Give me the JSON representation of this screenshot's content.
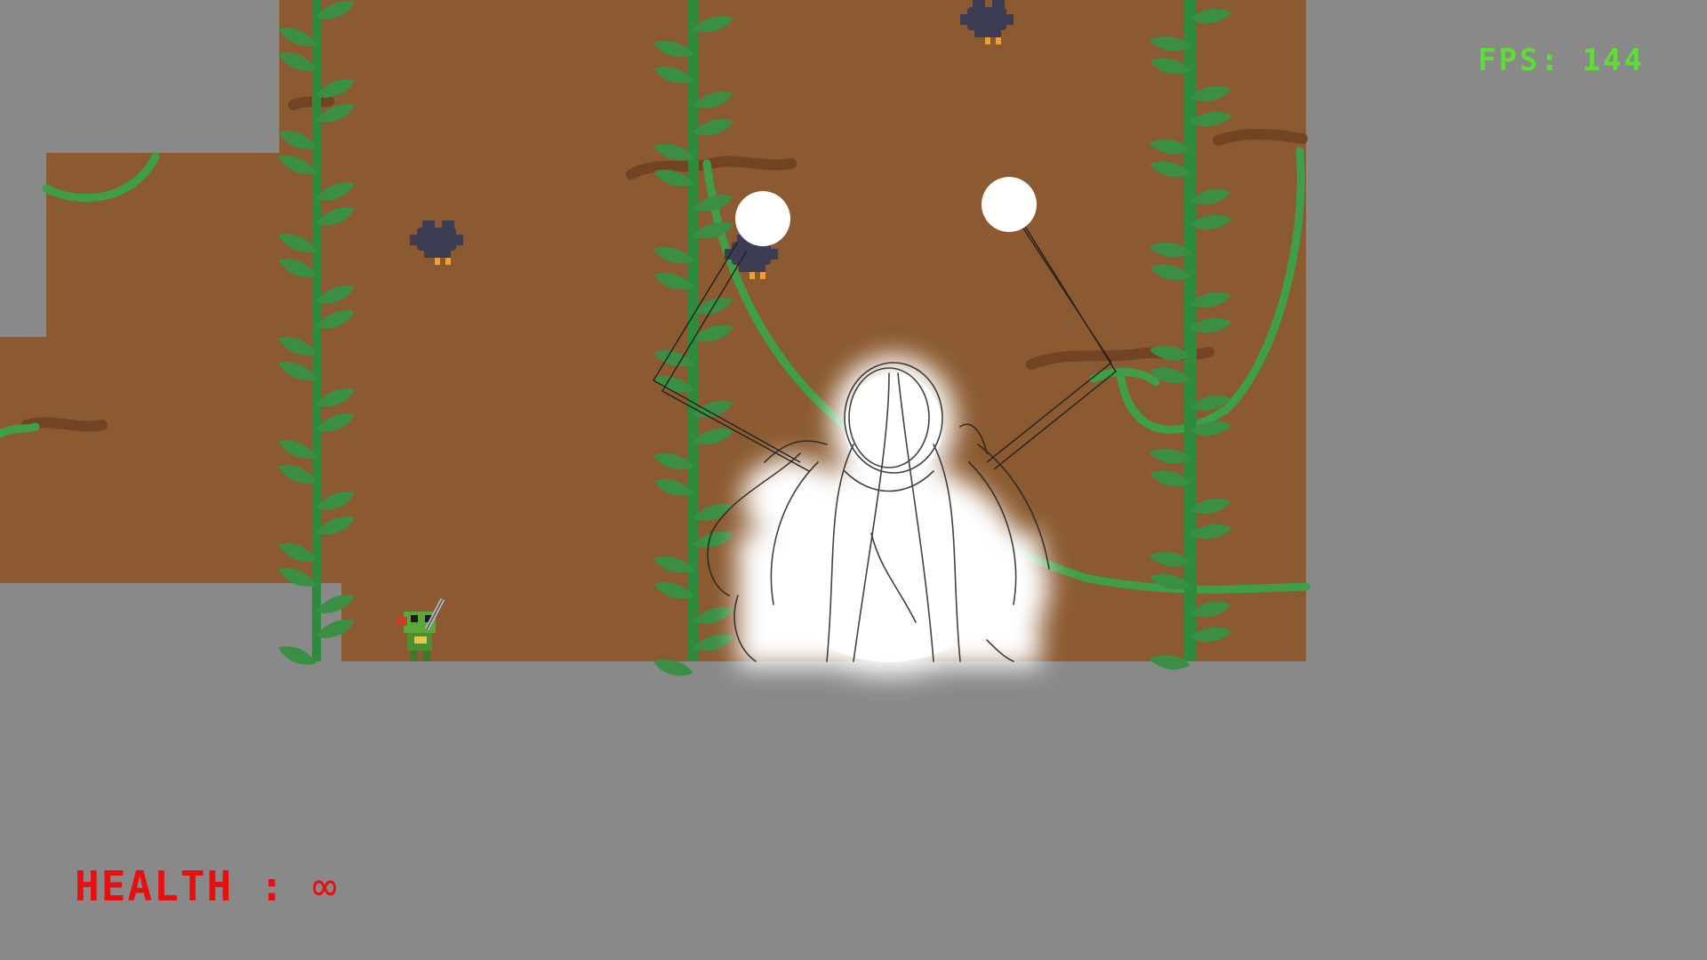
{
  "hud": {
    "fps_label": "FPS: 144",
    "health_label": "HEALTH :",
    "health_value": "∞"
  },
  "colors": {
    "background": "#898989",
    "wall": "#8b5a30",
    "vine": "#3f9f48",
    "vine_dark": "#2e8a3c",
    "leaf": "#3a8f45",
    "fps_text": "#5fdc3a",
    "health_text": "#e80f0f",
    "boss_glow": "#ffffff",
    "bird": "#3d3c55",
    "bird_feet": "#f0a030"
  },
  "entities": {
    "player": {
      "name": "frog knight",
      "icon": "frog-knight-player-sprite"
    },
    "enemies": [
      "crow-enemy",
      "crow-enemy",
      "crow-enemy"
    ],
    "boss": {
      "icon": "white-wraith-boss"
    },
    "orbs": [
      "white-orb",
      "white-orb"
    ]
  }
}
